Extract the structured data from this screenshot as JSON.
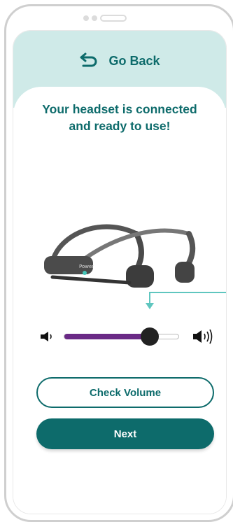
{
  "header": {
    "back_label": "Go Back"
  },
  "message": {
    "line1": "Your headset is connected",
    "line2": "and ready to use!"
  },
  "headset": {
    "brand_text": "Power"
  },
  "volume": {
    "level": 0.75
  },
  "buttons": {
    "check_volume": "Check Volume",
    "next": "Next"
  },
  "colors": {
    "teal": "#0d6b6b",
    "header_bg": "#cfeae8",
    "slider_fill": "#6a2a86",
    "pointer": "#5fc6bf"
  }
}
